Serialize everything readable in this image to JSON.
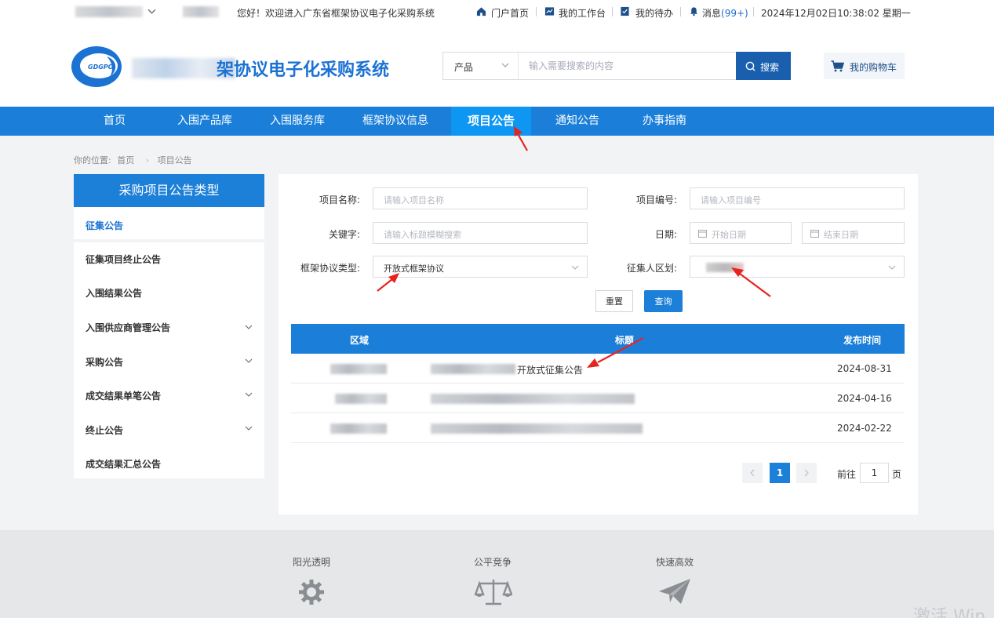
{
  "topbar": {
    "greeting": "您好！欢迎进入广东省框架协议电子化采购系统",
    "links": {
      "portal": "门户首页",
      "workbench": "我的工作台",
      "todo": "我的待办",
      "messages": "消息",
      "message_count": "(99+)"
    },
    "datetime": "2024年12月02日10:38:02 星期一"
  },
  "header": {
    "logo_badge": "GDGPO",
    "system_name_visible": "架协议电子化采购系统",
    "search": {
      "category": "产品",
      "placeholder": "输入需要搜索的内容",
      "button": "搜索"
    },
    "cart": "我的购物车"
  },
  "nav": {
    "items": [
      "首页",
      "入围产品库",
      "入围服务库",
      "框架协议信息",
      "项目公告",
      "通知公告",
      "办事指南"
    ],
    "active": "项目公告"
  },
  "breadcrumb": {
    "prefix": "你的位置:",
    "home": "首页",
    "current": "项目公告"
  },
  "sidebar": {
    "title": "采购项目公告类型",
    "items": [
      {
        "label": "征集公告",
        "active": true,
        "expandable": false
      },
      {
        "label": "征集项目终止公告",
        "active": false,
        "expandable": false
      },
      {
        "label": "入围结果公告",
        "active": false,
        "expandable": false
      },
      {
        "label": "入围供应商管理公告",
        "active": false,
        "expandable": true
      },
      {
        "label": "采购公告",
        "active": false,
        "expandable": true
      },
      {
        "label": "成交结果单笔公告",
        "active": false,
        "expandable": true
      },
      {
        "label": "终止公告",
        "active": false,
        "expandable": true
      },
      {
        "label": "成交结果汇总公告",
        "active": false,
        "expandable": false
      }
    ]
  },
  "filters": {
    "project_name": {
      "label": "项目名称:",
      "placeholder": "请输入项目名称"
    },
    "project_code": {
      "label": "项目编号:",
      "placeholder": "请输入项目编号"
    },
    "keyword": {
      "label": "关键字:",
      "placeholder": "请输入标题模糊搜索"
    },
    "date": {
      "label": "日期:",
      "start_placeholder": "开始日期",
      "end_placeholder": "结束日期"
    },
    "agreement_type": {
      "label": "框架协议类型:",
      "value": "开放式框架协议"
    },
    "region": {
      "label": "征集人区划:"
    },
    "reset_button": "重置",
    "query_button": "查询"
  },
  "table": {
    "headers": {
      "region": "区域",
      "title": "标题",
      "date": "发布时间"
    },
    "rows": [
      {
        "title_visible": "开放式征集公告",
        "date": "2024-08-31"
      },
      {
        "title_visible": "",
        "date": "2024-04-16"
      },
      {
        "title_visible": "",
        "date": "2024-02-22"
      }
    ]
  },
  "pagination": {
    "current_page": "1",
    "goto_label": "前往",
    "goto_value": "1",
    "unit": "页"
  },
  "footer": {
    "items": [
      "阳光透明",
      "公平竞争",
      "快速高效"
    ]
  },
  "watermark": "激活 Win",
  "colors": {
    "primary": "#1b7fd9",
    "nav_active": "#0d96f2",
    "search_button": "#1a5fae",
    "annotation_arrow": "#e8231f"
  }
}
